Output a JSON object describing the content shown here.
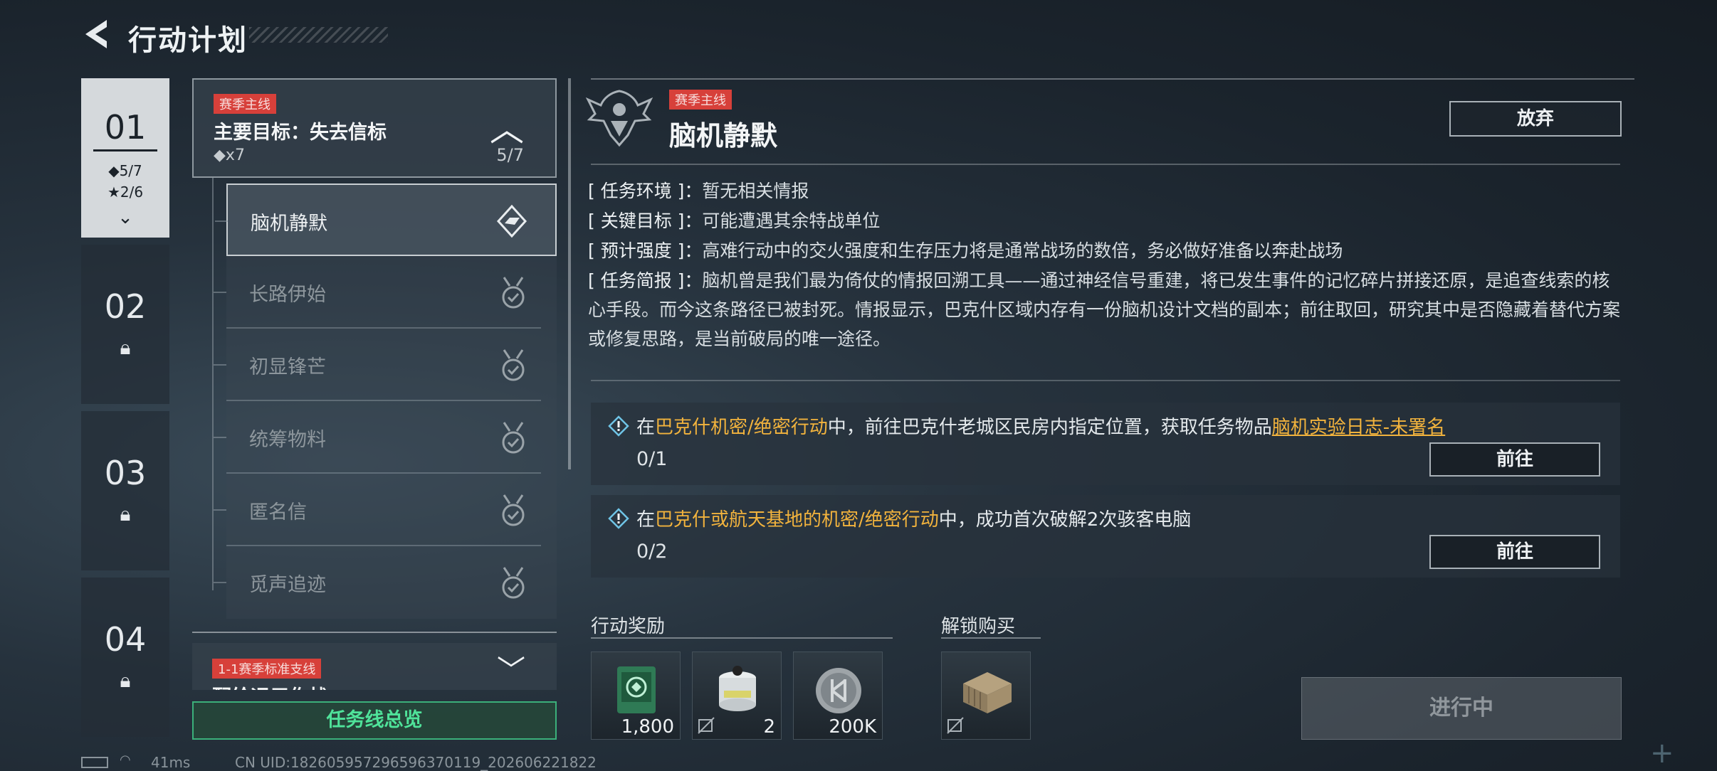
{
  "header": {
    "title": "行动计划"
  },
  "chapters": [
    {
      "number": "01",
      "diamonds": "◆5/7",
      "stars": "★2/6",
      "locked": false
    },
    {
      "number": "02",
      "locked": true
    },
    {
      "number": "03",
      "locked": true
    },
    {
      "number": "04",
      "locked": true
    }
  ],
  "main_goal": {
    "tag": "赛季主线",
    "title": "主要目标：失去信标",
    "count": "◆x7",
    "progress": "5/7"
  },
  "missions": [
    {
      "label": "脑机静默",
      "selected": true
    },
    {
      "label": "长路伊始",
      "selected": false
    },
    {
      "label": "初显锋芒",
      "selected": false
    },
    {
      "label": "统筹物料",
      "selected": false
    },
    {
      "label": "匿名信",
      "selected": false
    },
    {
      "label": "觅声追迹",
      "selected": false
    }
  ],
  "side_line": {
    "tag": "1-1赛季标准支线",
    "title": "配给运用作战"
  },
  "overview_button": "任务线总览",
  "detail": {
    "tag": "赛季主线",
    "title": "脑机静默",
    "abandon": "放弃",
    "info": {
      "env_key": "[ 任务环境 ]：",
      "env_val": "暂无相关情报",
      "target_key": "[ 关键目标 ]：",
      "target_val": "可能遭遇其余特战单位",
      "intensity_key": "[ 预计强度 ]：",
      "intensity_val": "高难行动中的交火强度和生存压力将是通常战场的数倍，务必做好准备以奔赴战场",
      "brief_key": "[ 任务简报 ]：",
      "brief_val": "脑机曾是我们最为倚仗的情报回溯工具——通过神经信号重建，将已发生事件的记忆碎片拼接还原，是追查线索的核心手段。而今这条路径已被封死。情报显示，巴克什区域内存有一份脑机设计文档的副本；前往取回，研究其中是否隐藏着替代方案或修复思路，是当前破局的唯一途径。"
    },
    "tasks": [
      {
        "pre": "在",
        "hl": "巴克什机密/绝密行动",
        "mid": "中，前往巴克什老城区民房内指定位置，获取任务物品",
        "link": "脑机实验日志-未署名",
        "progress": "0/1",
        "go": "前往"
      },
      {
        "pre": "在",
        "hl": "巴克什或航天基地的机密/绝密行动",
        "mid": "中，成功首次破解2次骇客电脑",
        "link": "",
        "progress": "0/2",
        "go": "前往"
      }
    ],
    "rewards_label": "行动奖励",
    "rewards": [
      {
        "icon": "emblem-chip-icon",
        "qty": "1,800",
        "bound": false
      },
      {
        "icon": "canister-icon",
        "qty": "2",
        "bound": true
      },
      {
        "icon": "coin-icon",
        "qty": "200K",
        "bound": false
      }
    ],
    "unlock_label": "解锁购买",
    "unlock_item": {
      "icon": "crate-icon",
      "bound": true
    },
    "status_button": "进行中"
  },
  "footer": {
    "ping": "41ms",
    "uid": "CN UID:18260595729659637011​9_202606221822"
  },
  "colors": {
    "accent_green": "#4fe39a",
    "highlight": "#f2b33d",
    "tag_red": "#d7403a"
  }
}
